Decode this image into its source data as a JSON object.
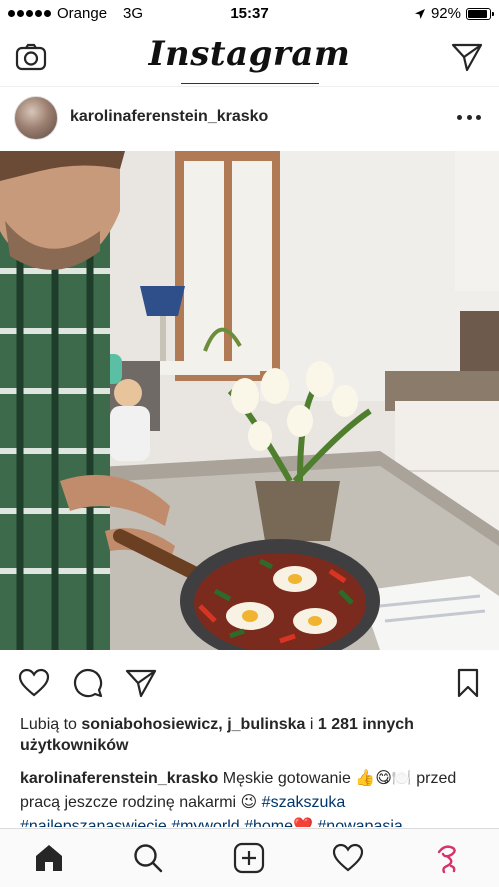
{
  "status_bar": {
    "carrier": "Orange",
    "network": "3G",
    "time": "15:37",
    "battery": "92%",
    "battery_level": 0.92
  },
  "top_nav": {
    "logo": "Instagram",
    "left_icon": "camera-icon",
    "right_icon": "direct-send-icon"
  },
  "post": {
    "username": "karolinaferenstein_krasko",
    "photo_description_icon": "post-photo"
  },
  "actions": {
    "like_icon": "heart-icon",
    "comment_icon": "comment-icon",
    "share_icon": "send-icon",
    "save_icon": "bookmark-icon"
  },
  "likes": {
    "prefix": "Lubią to ",
    "users": "soniabohosiewicz, j_bulinska",
    "middle": " i ",
    "others": "1 281 innych użytkowników"
  },
  "caption": {
    "username": "karolinaferenstein_krasko",
    "text": " Męskie gotowanie 👍😋🍽️ przed pracą jeszcze rodzinę nakarmi 😉 ",
    "tag1": "#szakszuka",
    "tags_line2": "#najlepszanaswiecie #myworld #home❤️ #nowapasja"
  },
  "tab_bar": {
    "items": [
      "home-icon",
      "search-icon",
      "add-post-icon",
      "activity-heart-icon",
      "profile-icon"
    ]
  },
  "colors": {
    "text": "#262626",
    "hashtag": "#003569",
    "tab_bar_bg": "#fafafa",
    "divider": "#dbdbdb"
  }
}
